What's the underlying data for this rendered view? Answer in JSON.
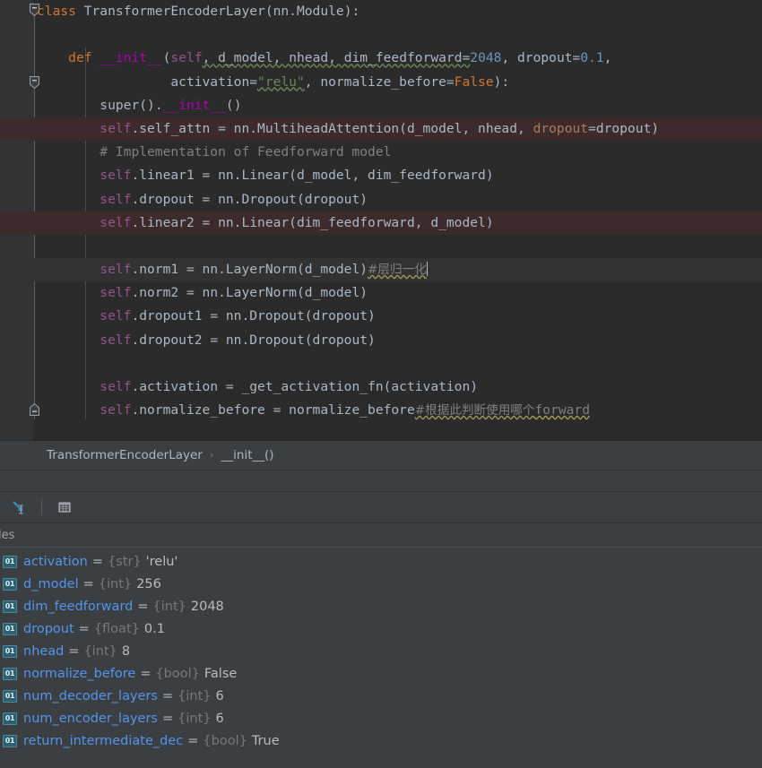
{
  "editor": {
    "background": "#2b2b2b",
    "highlight_color": "#3d2b2b",
    "breakpoint_color": "#db5c5c",
    "lines": [
      {
        "id": "line-class",
        "tokens": "class TransformerEncoderLayer(nn.Module):"
      },
      {
        "id": "line-blank-1",
        "tokens": ""
      },
      {
        "id": "line-def-init",
        "tokens": "def __init__(self, d_model, nhead, dim_feedforward=2048, dropout=0.1,"
      },
      {
        "id": "line-def-cont",
        "tokens": "activation=\"relu\", normalize_before=False):"
      },
      {
        "id": "line-super",
        "tokens": "super().__init__()"
      },
      {
        "id": "line-self-attn",
        "tokens": "self.self_attn = nn.MultiheadAttention(d_model, nhead, dropout=dropout)"
      },
      {
        "id": "line-comment-ff",
        "tokens": "# Implementation of Feedforward model"
      },
      {
        "id": "line-linear1",
        "tokens": "self.linear1 = nn.Linear(d_model, dim_feedforward)"
      },
      {
        "id": "line-dropout",
        "tokens": "self.dropout = nn.Dropout(dropout)"
      },
      {
        "id": "line-linear2",
        "tokens": "self.linear2 = nn.Linear(dim_feedforward, d_model)"
      },
      {
        "id": "line-blank-2",
        "tokens": ""
      },
      {
        "id": "line-norm1",
        "tokens": "self.norm1 = nn.LayerNorm(d_model)#层归一化"
      },
      {
        "id": "line-norm2",
        "tokens": "self.norm2 = nn.LayerNorm(d_model)"
      },
      {
        "id": "line-dropout1",
        "tokens": "self.dropout1 = nn.Dropout(dropout)"
      },
      {
        "id": "line-dropout2",
        "tokens": "self.dropout2 = nn.Dropout(dropout)"
      },
      {
        "id": "line-blank-3",
        "tokens": ""
      },
      {
        "id": "line-activation",
        "tokens": "self.activation = _get_activation_fn(activation)"
      },
      {
        "id": "line-normalize-before",
        "tokens": "self.normalize_before = normalize_before#根据此判断使用哪个forward"
      }
    ],
    "text": {
      "kw_class": "class",
      "class_name": "TransformerEncoderLayer",
      "class_sig": "(nn.Module):",
      "kw_def": "def",
      "fn_init": "__init__",
      "init_open": "(",
      "self_kw": "self",
      "params_1": ", d_model, nhead, dim_feedforward=",
      "dim_ff_value": "2048",
      "params_2": ", dropout=",
      "dropout_value": "0.1",
      "params_3": ",",
      "indent_cont": "             ",
      "activation_kw": "activation=",
      "relu_str": "\"relu\"",
      "params_4": ", normalize_before=",
      "false_kw": "False",
      "params_5": "):",
      "super_call": "super()",
      "super_dot": ".",
      "super_init": "__init__",
      "super_parens": "()",
      "self_prefix": "self",
      "attn_attr": ".self_attn = nn.MultiheadAttention(d_model, nhead, ",
      "attn_kwarg": "dropout",
      "attn_tail": "=dropout)",
      "comment_ff": "# Implementation of Feedforward model",
      "linear1_attr": ".linear1 = nn.Linear(d_model, dim_feedforward)",
      "dropout_attr": ".dropout = nn.Dropout(dropout)",
      "linear2_attr": ".linear2 = nn.Linear(dim_feedforward, d_model)",
      "norm1_attr": ".norm1 = nn.LayerNorm(d_model)",
      "norm1_comment": "#层归一化",
      "norm2_attr": ".norm2 = nn.LayerNorm(d_model)",
      "dropout1_attr": ".dropout1 = nn.Dropout(dropout)",
      "dropout2_attr": ".dropout2 = nn.Dropout(dropout)",
      "activation_attr": ".activation = _get_activation_fn(activation)",
      "normbefore_attr": ".normalize_before = normalize_before",
      "normbefore_comment": "#根据此判断使用哪个",
      "normbefore_comment_fw": "forward"
    }
  },
  "breadcrumb": {
    "items": [
      "TransformerEncoderLayer",
      "__init__()"
    ],
    "separator": "›"
  },
  "debug": {
    "toolbar": {
      "evaluate_label": "evaluate-expression",
      "table_label": "view-as-table"
    },
    "tab_label": "les",
    "variables": [
      {
        "name": "activation",
        "type": "{str}",
        "value": "'relu'"
      },
      {
        "name": "d_model",
        "type": "{int}",
        "value": "256"
      },
      {
        "name": "dim_feedforward",
        "type": "{int}",
        "value": "2048"
      },
      {
        "name": "dropout",
        "type": "{float}",
        "value": "0.1"
      },
      {
        "name": "nhead",
        "type": "{int}",
        "value": "8"
      },
      {
        "name": "normalize_before",
        "type": "{bool}",
        "value": "False"
      },
      {
        "name": "num_decoder_layers",
        "type": "{int}",
        "value": "6"
      },
      {
        "name": "num_encoder_layers",
        "type": "{int}",
        "value": "6"
      },
      {
        "name": "return_intermediate_dec",
        "type": "{bool}",
        "value": "True"
      }
    ],
    "equals": "=",
    "icon_text": "01",
    "name_color": "#5394ec",
    "type_color": "#787878"
  }
}
